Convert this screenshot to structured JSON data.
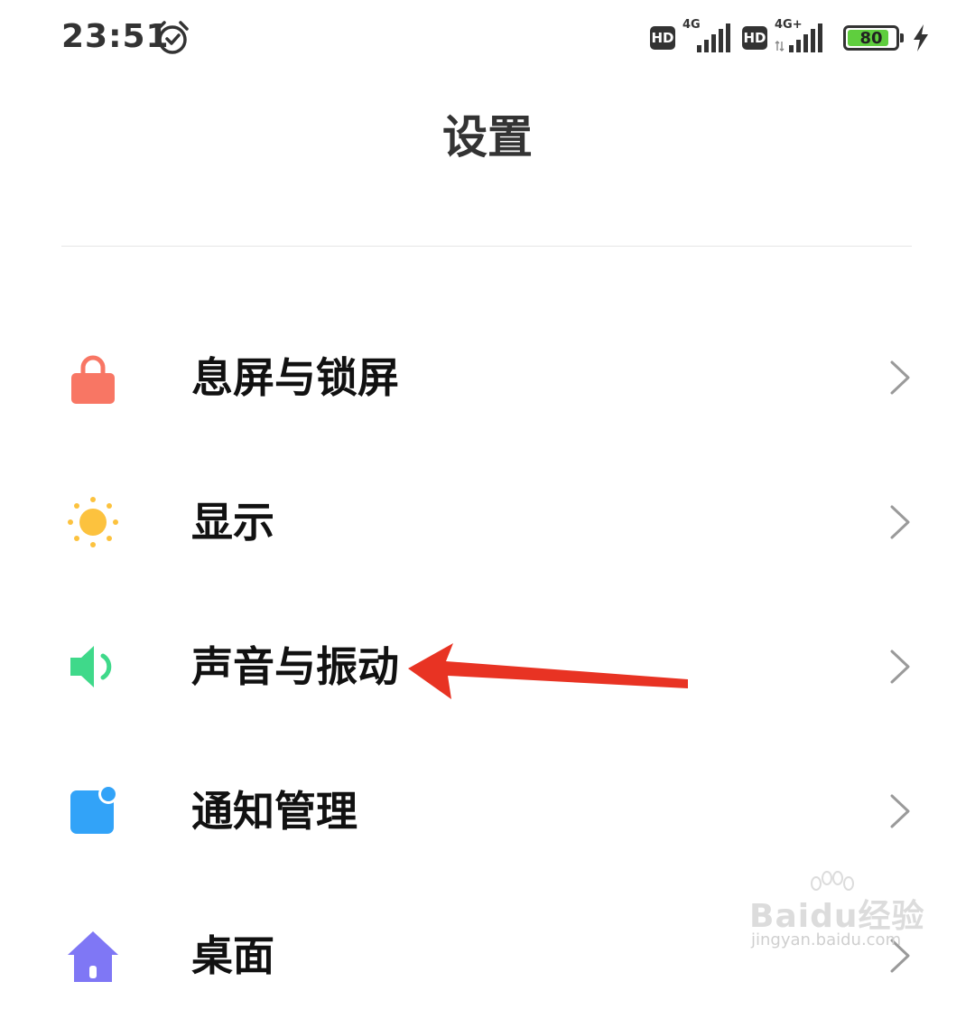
{
  "status_bar": {
    "time": "23:51",
    "alarm_icon": "alarm-clock-icon",
    "sim1": {
      "hd": "HD",
      "network": "4G"
    },
    "sim2": {
      "hd": "HD",
      "network": "4G+"
    },
    "battery_level": "80",
    "battery_fraction": 0.8,
    "battery_color": "#5fce3e",
    "charging_icon": "lightning-bolt-icon"
  },
  "page": {
    "title": "设置"
  },
  "settings_items": [
    {
      "label": "息屏与锁屏",
      "icon": "lock-icon",
      "color": "#f87664"
    },
    {
      "label": "显示",
      "icon": "sun-icon",
      "color": "#fcc23e"
    },
    {
      "label": "声音与振动",
      "icon": "speaker-icon",
      "color": "#3fd98a"
    },
    {
      "label": "通知管理",
      "icon": "notification-icon",
      "color": "#32a3f8"
    },
    {
      "label": "桌面",
      "icon": "home-icon",
      "color": "#7f77f5"
    }
  ],
  "annotation": {
    "arrow_color": "#e83323"
  },
  "watermark": {
    "brand": "Bai",
    "brand2": "du",
    "brand_cn": "经验",
    "url": "jingyan.baidu.com"
  }
}
